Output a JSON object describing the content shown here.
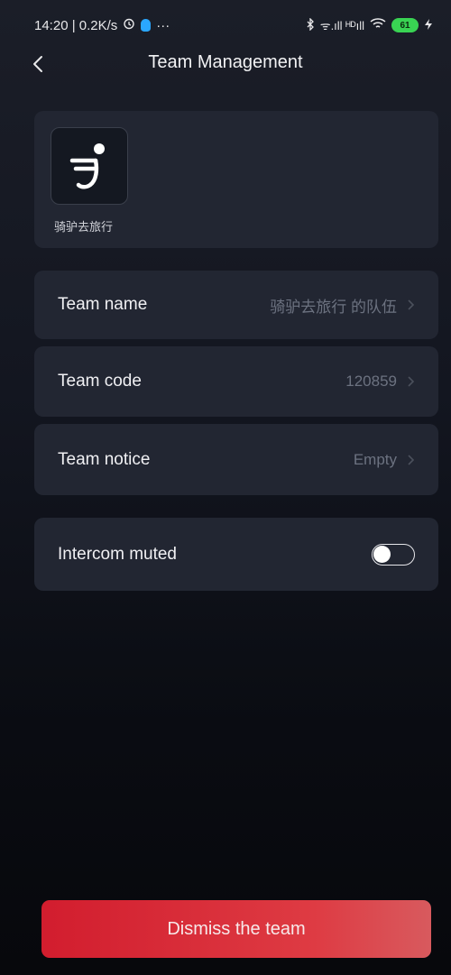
{
  "status_bar": {
    "left_text": "14:20 | 0.2K/s",
    "dots": "···",
    "signal_text": "ᯤ.ıll ᴴᴰıll",
    "battery": "61"
  },
  "header": {
    "title": "Team Management"
  },
  "team_logo": {
    "caption": "骑驴去旅行"
  },
  "rows": {
    "name": {
      "label": "Team name",
      "value": "骑驴去旅行 的队伍"
    },
    "code": {
      "label": "Team code",
      "value": "120859"
    },
    "notice": {
      "label": "Team notice",
      "value": "Empty"
    },
    "intercom": {
      "label": "Intercom muted",
      "toggle_on": false
    }
  },
  "footer": {
    "dismiss_label": "Dismiss the team"
  },
  "colors": {
    "card": "#222632",
    "value_text": "#6c7280",
    "danger": "#d21d2e"
  }
}
